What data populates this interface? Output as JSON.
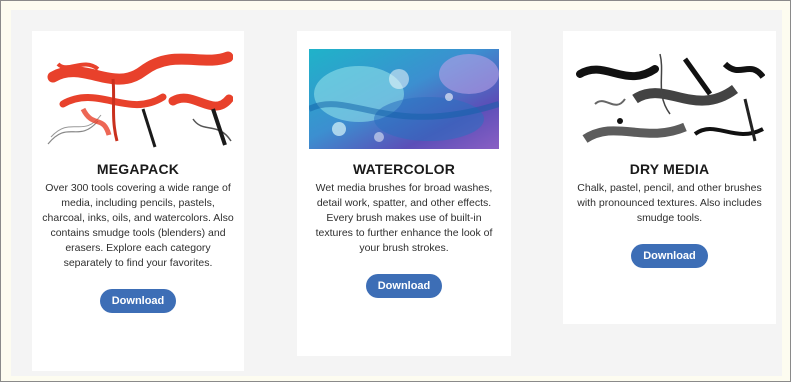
{
  "cards": [
    {
      "title": "MEGAPACK",
      "description": "Over 300 tools covering a wide range of media, including pencils, pastels, charcoal, inks, oils, and watercolors. Also contains smudge tools (blenders) and erasers. Explore each category separately to find your favorites.",
      "button_label": "Download",
      "image": "red-ink-brush-strokes"
    },
    {
      "title": "WATERCOLOR",
      "description": "Wet media brushes for broad washes, detail work, spatter, and other effects. Every brush makes use of built-in textures to further enhance the look of your brush strokes.",
      "button_label": "Download",
      "image": "blue-watercolor-wash"
    },
    {
      "title": "DRY MEDIA",
      "description": "Chalk, pastel, pencil, and other brushes with pronounced textures. Also includes smudge tools.",
      "button_label": "Download",
      "image": "black-charcoal-strokes"
    }
  ],
  "colors": {
    "button": "#3d6eb6",
    "panel_background": "#f4f4f4",
    "card_background": "#ffffff",
    "megapack_accent": "#e8412b",
    "watercolor_accent": "#2aa8c8"
  }
}
